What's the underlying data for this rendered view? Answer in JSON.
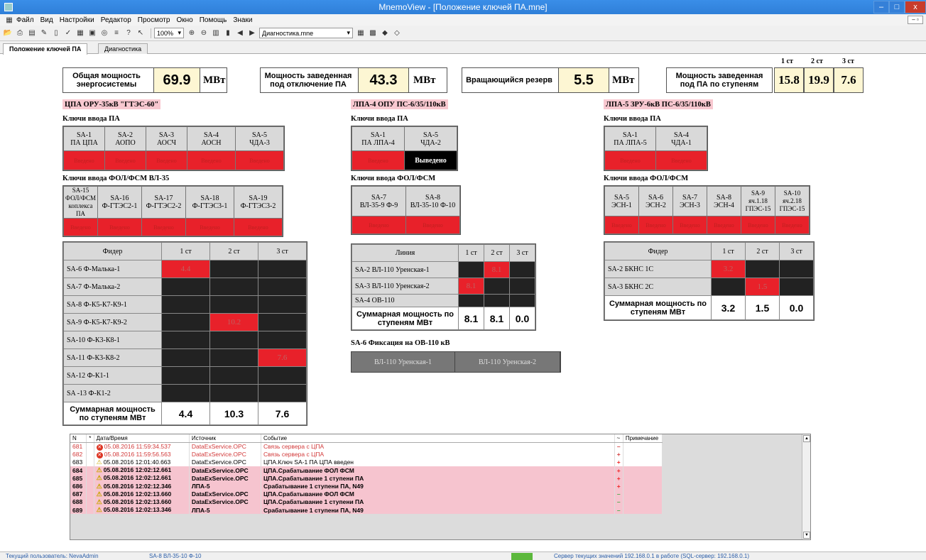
{
  "window": {
    "title": "MnemoView - [Положение ключей ПА.mne]",
    "minimize": "–",
    "restore": "□",
    "close": "x"
  },
  "menu": [
    "Файл",
    "Вид",
    "Настройки",
    "Редактор",
    "Просмотр",
    "Окно",
    "Помощь",
    "Знаки"
  ],
  "toolbar": {
    "zoom": "100%",
    "scheme": "Диагностика.mne"
  },
  "tabs": [
    "Положение ключей ПА",
    "Диагностика"
  ],
  "header": {
    "total": {
      "label": "Общая мощность энергосистемы",
      "value": "69.9",
      "unit": "МВт"
    },
    "armed": {
      "label": "Мощность заведенная под отключение ПА",
      "value": "43.3",
      "unit": "МВт"
    },
    "reserve": {
      "label": "Вращающийся резерв",
      "value": "5.5",
      "unit": "МВт"
    },
    "stages": {
      "label": "Мощность заведенная под ПА по ступеням",
      "heads": [
        "1 ст",
        "2 ст",
        "3 ст"
      ],
      "values": [
        "15.8",
        "19.9",
        "7.6"
      ]
    }
  },
  "cpa": {
    "title": "ЦПА ОРУ-35кВ \"ГТЭС-60\"",
    "keys_title": "Ключи ввода ПА",
    "keys": [
      {
        "line1": "SA-1",
        "line2": "ПА ЦПА",
        "state": "Введено"
      },
      {
        "line1": "SA-2",
        "line2": "АОПО",
        "state": "Введено"
      },
      {
        "line1": "SA-3",
        "line2": "АОСЧ",
        "state": "Введено"
      },
      {
        "line1": "SA-4",
        "line2": "АОСН",
        "state": "Введено"
      },
      {
        "line1": "SA-5",
        "line2": "ЧДА-3",
        "state": "Введено"
      }
    ],
    "fol_title": "Ключи ввода ФОЛ/ФСМ ВЛ-35",
    "fol_keys": [
      {
        "line1": "SA-15",
        "line2": "ФОЛ/ФСМ",
        "line3": "коплекса ПА",
        "state": "Введено"
      },
      {
        "line1": "SA-16",
        "line2": "Ф-ГТЭС2-1",
        "line3": "",
        "state": "Введено"
      },
      {
        "line1": "SA-17",
        "line2": "Ф-ГТЭС2-2",
        "line3": "",
        "state": "Введено"
      },
      {
        "line1": "SA-18",
        "line2": "Ф-ГТЭС3-1",
        "line3": "",
        "state": "Введено"
      },
      {
        "line1": "SA-19",
        "line2": "Ф-ГТЭС3-2",
        "line3": "",
        "state": "Введено"
      }
    ],
    "feeders": {
      "heads": [
        "Фидер",
        "1 ст",
        "2 ст",
        "3 ст"
      ],
      "rows": [
        {
          "name": "SA-6  Ф-Малька-1",
          "c": [
            "4.4",
            "",
            ""
          ]
        },
        {
          "name": "SA-7  Ф-Малька-2",
          "c": [
            "",
            "",
            ""
          ]
        },
        {
          "name": "SA-8  Ф-К5-К7-К9-1",
          "c": [
            "",
            "",
            ""
          ]
        },
        {
          "name": "SA-9  Ф-К5-К7-К9-2",
          "c": [
            "",
            "10.2",
            ""
          ]
        },
        {
          "name": "SA-10 Ф-К3-К8-1",
          "c": [
            "",
            "",
            ""
          ]
        },
        {
          "name": "SA-11 Ф-К3-К8-2",
          "c": [
            "",
            "",
            "7.6"
          ]
        },
        {
          "name": "SA-12 Ф-К1-1",
          "c": [
            "",
            "",
            ""
          ]
        },
        {
          "name": "SA -13 Ф-К1-2",
          "c": [
            "",
            "",
            ""
          ]
        }
      ],
      "sum_label": "Суммарная мощность по ступеням МВт",
      "sums": [
        "4.4",
        "10.3",
        "7.6"
      ]
    }
  },
  "lpa4": {
    "title": "ЛПА-4  ОПУ ПС-6/35/110кВ",
    "keys_title": "Ключи ввода ПА",
    "keys": [
      {
        "line1": "SA-1",
        "line2": "ПА ЛПА-4",
        "state": "Введено",
        "off": false
      },
      {
        "line1": "SA-5",
        "line2": "ЧДА-2",
        "state": "Выведено",
        "off": true
      }
    ],
    "fol_title": "Ключи ввода ФОЛ/ФСМ",
    "fol_keys": [
      {
        "line1": "SA-7",
        "line2": "ВЛ-35-9 Ф-9",
        "state": "Введено"
      },
      {
        "line1": "SA-8",
        "line2": "ВЛ-35-10 Ф-10",
        "state": "Введено"
      }
    ],
    "lines": {
      "heads": [
        "Линия",
        "1 ст",
        "2 ст",
        "3 ст"
      ],
      "rows": [
        {
          "name": "SA-2 ВЛ-110 Уренская-1",
          "c": [
            "",
            "8.1",
            ""
          ]
        },
        {
          "name": "SA-3 ВЛ-110 Уренская-2",
          "c": [
            "8.1",
            "",
            ""
          ]
        },
        {
          "name": "SA-4 ОВ-110",
          "c": [
            "",
            "",
            ""
          ]
        }
      ],
      "sum_label": "Суммарная мощность по ступеням МВт",
      "sums": [
        "8.1",
        "8.1",
        "0.0"
      ]
    },
    "fix_title": "SA-6 Фиксация на ОВ-110 кВ",
    "fix": [
      "ВЛ-110 Уренская-1",
      "ВЛ-110 Уренская-2"
    ]
  },
  "lpa5": {
    "title": "ЛПА-5  ЗРУ-6кВ ПС-6/35/110кВ",
    "keys_title": "Ключи ввода ПА",
    "keys": [
      {
        "line1": "SA-1",
        "line2": "ПА ЛПА-5",
        "state": "Введено"
      },
      {
        "line1": "SA-4",
        "line2": "ЧДА-1",
        "state": "Введено"
      }
    ],
    "fol_title": "Ключи ввода ФОЛ/ФСМ",
    "fol_keys": [
      {
        "line1": "SA-5",
        "line2": "ЭСН-1",
        "state": "Введено"
      },
      {
        "line1": "SA-6",
        "line2": "ЭСН-2",
        "state": "Введено"
      },
      {
        "line1": "SA-7",
        "line2": "ЭСН-3",
        "state": "Введено"
      },
      {
        "line1": "SA-8",
        "line2": "ЭСН-4",
        "state": "Введено"
      },
      {
        "line1": "SA-9",
        "line2": "яч.1.18",
        "line3": "ГПЭС-15",
        "state": "Введено"
      },
      {
        "line1": "SA-10",
        "line2": "яч.2.18",
        "line3": "ГПЭС-15",
        "state": "Введено"
      }
    ],
    "feeders": {
      "heads": [
        "Фидер",
        "1 ст",
        "2 ст",
        "3 ст"
      ],
      "rows": [
        {
          "name": "SA-2 БКНС 1С",
          "c": [
            "3.2",
            "",
            ""
          ]
        },
        {
          "name": "SA-3 БКНС 2С",
          "c": [
            "",
            "1.5",
            ""
          ]
        }
      ],
      "sum_label": "Суммарная мощность по ступеням МВт",
      "sums": [
        "3.2",
        "1.5",
        "0.0"
      ]
    }
  },
  "log": {
    "heads": [
      "N",
      "*",
      "Дата/Время",
      "Источник",
      "Событие",
      "~",
      "Примечание"
    ],
    "rows": [
      {
        "n": "681",
        "type": "err",
        "dt": "05.08.2016 11:59:34.537",
        "src": "DataExService.OPC",
        "ev": "Связь сервера с ЦПА",
        "mark": "–",
        "style": "red"
      },
      {
        "n": "682",
        "type": "err",
        "dt": "05.08.2016 11:59:56.563",
        "src": "DataExService.OPC",
        "ev": "Связь сервера с ЦПА",
        "mark": "+",
        "style": "red"
      },
      {
        "n": "683",
        "type": "warn",
        "dt": "05.08.2016 12:01:40.663",
        "src": "DataExService.OPC",
        "ev": "ЦПА.Ключ SA-1 ПА ЦПА введен",
        "mark": "+",
        "style": "normal"
      },
      {
        "n": "684",
        "type": "warn",
        "dt": "05.08.2016 12:02:12.661",
        "src": "DataExService.OPC",
        "ev": "ЦПА.Срабатывание ФОЛ ФСМ",
        "mark": "+",
        "style": "alarm"
      },
      {
        "n": "685",
        "type": "warn",
        "dt": "05.08.2016 12:02:12.661",
        "src": "DataExService.OPC",
        "ev": "ЦПА.Срабатывание 1 ступени ПА",
        "mark": "+",
        "style": "alarm"
      },
      {
        "n": "686",
        "type": "warn",
        "dt": "05.08.2016 12:02:12.346",
        "src": "ЛПА-5",
        "ev": "Срабатывание 1 ступени ПА, N49",
        "mark": "+",
        "style": "alarm"
      },
      {
        "n": "687",
        "type": "warn",
        "dt": "05.08.2016 12:02:13.660",
        "src": "DataExService.OPC",
        "ev": "ЦПА.Срабатывание ФОЛ ФСМ",
        "mark": "–",
        "style": "alarm"
      },
      {
        "n": "688",
        "type": "warn",
        "dt": "05.08.2016 12:02:13.660",
        "src": "DataExService.OPC",
        "ev": "ЦПА.Срабатывание 1 ступени ПА",
        "mark": "–",
        "style": "alarm"
      },
      {
        "n": "689",
        "type": "warn",
        "dt": "05.08.2016 12:02:13.346",
        "src": "ЛПА-5",
        "ev": "Срабатывание 1 ступени ПА, N49",
        "mark": "–",
        "style": "alarm"
      }
    ]
  },
  "status": {
    "user": "Текущий пользователь: NevaAdmin",
    "selection": "SA-8  ВЛ-35-10 Ф-10",
    "server": "Сервер текущих значений 192.168.0.1 в работе  (SQL-сервер: 192.168.0.1)"
  }
}
